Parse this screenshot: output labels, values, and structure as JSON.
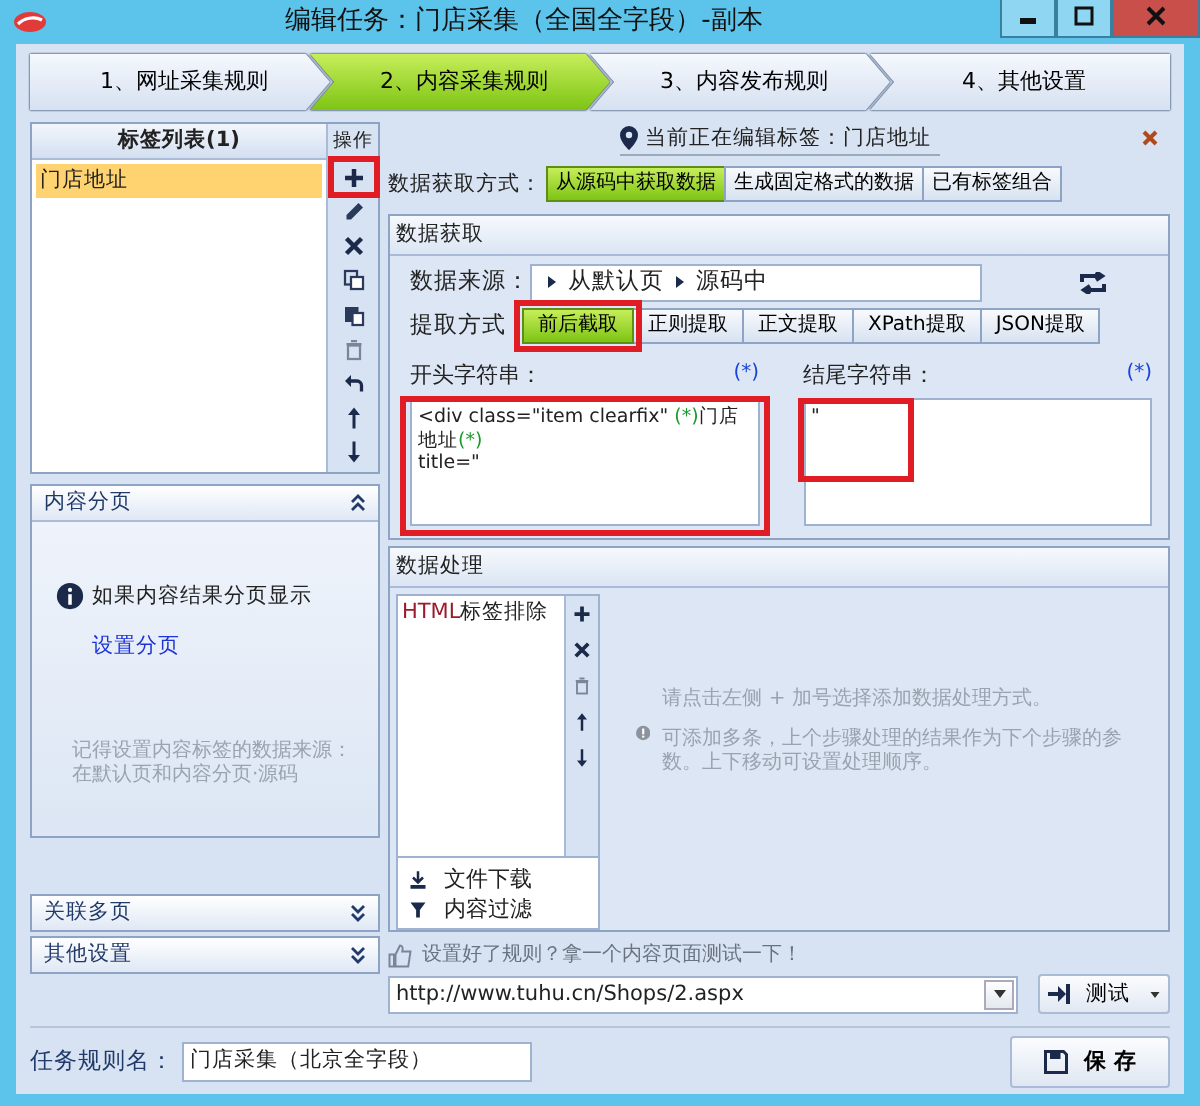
{
  "window": {
    "title": "编辑任务：门店采集（全国全字段）-副本"
  },
  "steps": [
    {
      "label": "1、网址采集规则",
      "selected": false
    },
    {
      "label": "2、内容采集规则",
      "selected": true
    },
    {
      "label": "3、内容发布规则",
      "selected": false
    },
    {
      "label": "4、其他设置",
      "selected": false
    }
  ],
  "tag_list": {
    "title": "标签列表(1)",
    "items": [
      {
        "label": "门店地址",
        "selected": true
      }
    ]
  },
  "operations": {
    "title": "操作",
    "tools": [
      {
        "kind": "plus",
        "highlighted": true
      },
      {
        "kind": "pencil",
        "highlighted": false
      },
      {
        "kind": "cross",
        "highlighted": false
      },
      {
        "kind": "copy",
        "highlighted": false
      },
      {
        "kind": "paste",
        "highlighted": false
      },
      {
        "kind": "trash",
        "highlighted": false
      },
      {
        "kind": "undo",
        "highlighted": false
      },
      {
        "kind": "up",
        "highlighted": false
      },
      {
        "kind": "down",
        "highlighted": false
      }
    ]
  },
  "paging_panel": {
    "title": "内容分页",
    "expanded": true,
    "info": "如果内容结果分页显示",
    "link": "设置分页",
    "note": "记得设置内容标签的数据来源：在默认页和内容分页·源码"
  },
  "collapsed_panels": [
    {
      "title": "关联多页",
      "expanded": false
    },
    {
      "title": "其他设置",
      "expanded": false
    }
  ],
  "editing": {
    "text": "当前正在编辑标签：门店地址"
  },
  "fetch_method": {
    "label": "数据获取方式：",
    "options": [
      {
        "label": "从源码中获取数据",
        "selected": true
      },
      {
        "label": "生成固定格式的数据",
        "selected": false
      },
      {
        "label": "已有标签组合",
        "selected": false
      }
    ]
  },
  "data_fetch": {
    "title": "数据获取",
    "source_label": "数据来源：",
    "source_path": [
      "从默认页",
      "源码中"
    ],
    "extract_label": "提取方式",
    "extract_modes": [
      {
        "label": "前后截取",
        "selected": true,
        "highlighted": true
      },
      {
        "label": "正则提取",
        "selected": false,
        "highlighted": false
      },
      {
        "label": "正文提取",
        "selected": false,
        "highlighted": false
      },
      {
        "label": "XPath提取",
        "selected": false,
        "highlighted": false
      },
      {
        "label": "JSON提取",
        "selected": false,
        "highlighted": false
      }
    ],
    "start": {
      "label": "开头字符串：",
      "wildcard": "(*)",
      "highlighted": true,
      "lines": [
        [
          {
            "text": "<div class=\"item clearfix\" "
          },
          {
            "text": "(*)",
            "kind": "wildcard"
          },
          {
            "text": "门店地址"
          },
          {
            "text": "(*)",
            "kind": "wildcard"
          }
        ],
        [
          {
            "text": "title=\""
          }
        ]
      ]
    },
    "end": {
      "label": "结尾字符串：",
      "wildcard": "(*)",
      "highlighted": true,
      "lines": [
        [
          {
            "text": "\""
          }
        ]
      ]
    }
  },
  "processing": {
    "title": "数据处理",
    "steps": [
      {
        "segments": [
          {
            "text": "HTML",
            "kind": "keyword"
          },
          {
            "text": "标签排除",
            "kind": "plain"
          }
        ]
      }
    ],
    "tools": [
      {
        "kind": "plus"
      },
      {
        "kind": "cross"
      },
      {
        "kind": "trash"
      },
      {
        "kind": "up"
      },
      {
        "kind": "down"
      }
    ],
    "extras": [
      {
        "kind": "download",
        "label": "文件下载"
      },
      {
        "kind": "filter",
        "label": "内容过滤"
      }
    ],
    "hint": [
      "请点击左侧 + 加号选择添加数据处理方式。",
      "可添加多条，上个步骤处理的结果作为下个步骤的参数。上下移动可设置处理顺序。"
    ]
  },
  "test": {
    "hint": "设置好了规则？拿一个内容页面测试一下！",
    "url": "http://www.tuhu.cn/Shops/2.aspx",
    "button": "测试"
  },
  "footer": {
    "name_label": "任务规则名：",
    "name_value": "门店采集（北京全字段）",
    "save": "保 存"
  }
}
